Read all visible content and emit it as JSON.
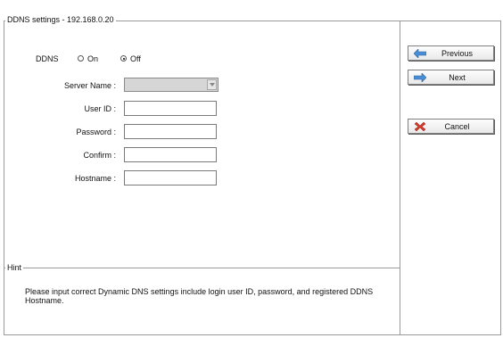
{
  "settings": {
    "legend": "DDNS settings - 192.168.0.20",
    "ddns_label": "DDNS",
    "ddns_on_label": "On",
    "ddns_off_label": "Off",
    "ddns_selected": "Off",
    "server_name_label": "Server Name :",
    "server_name_value": "",
    "user_id_label": "User ID :",
    "user_id_value": "",
    "password_label": "Password :",
    "password_value": "",
    "confirm_label": "Confirm :",
    "confirm_value": "",
    "hostname_label": "Hostname :",
    "hostname_value": ""
  },
  "hint": {
    "legend": "Hint",
    "text": "Please input correct Dynamic DNS settings include login user ID, password, and registered DDNS Hostname."
  },
  "buttons": {
    "previous_label": "Previous",
    "next_label": "Next",
    "cancel_label": "Cancel",
    "previous_icon": "left-arrow-icon",
    "next_icon": "right-arrow-icon",
    "cancel_icon": "cancel-x-icon"
  },
  "colors": {
    "arrow_blue": "#4a8fd6",
    "cancel_red": "#d33a2a"
  }
}
